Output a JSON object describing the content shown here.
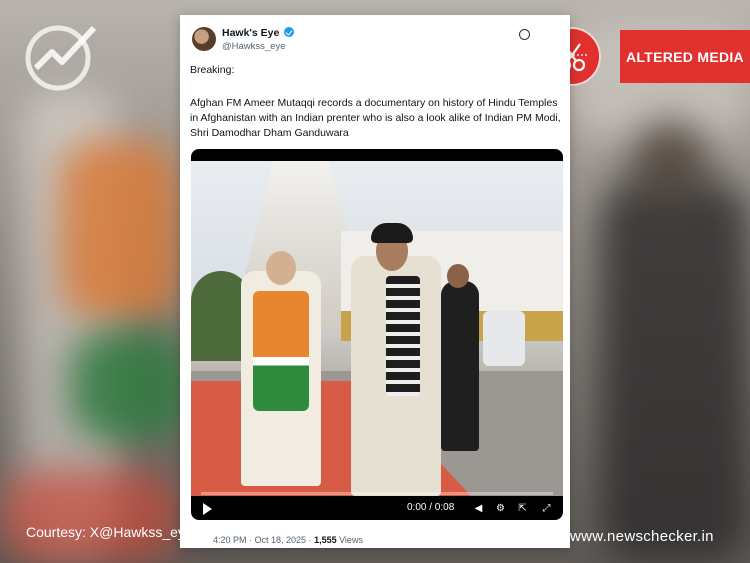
{
  "tweet": {
    "display_name": "Hawk's Eye",
    "handle": "@Hawkss_eye",
    "breaking": "Breaking:",
    "body": "Afghan FM Ameer Mutaqqi records a documentary on history of Hindu Temples in Afghanistan with an Indian prenter who is also a look alike of Indian PM Modi, Shri Damodhar Dham Ganduwara",
    "video_time": "0:00 / 0:08",
    "timestamp": "4:20 PM · Oct 18, 2025 · ",
    "views_count": "1,555",
    "views_label": " Views"
  },
  "badge": {
    "label": "ALTERED MEDIA",
    "color": "#e0312f",
    "icon": "scissors-icon"
  },
  "footer": {
    "courtesy": "Courtesy: X@Hawkss_eye",
    "site": "www.newschecker.in"
  },
  "icons": {
    "logo": "newschecker-logo-icon",
    "verified": "verified-badge-icon",
    "grok": "grok-icon",
    "play": "play-icon",
    "volume": "volume-icon",
    "settings": "settings-icon",
    "share": "share-icon",
    "fullscreen": "fullscreen-icon"
  }
}
